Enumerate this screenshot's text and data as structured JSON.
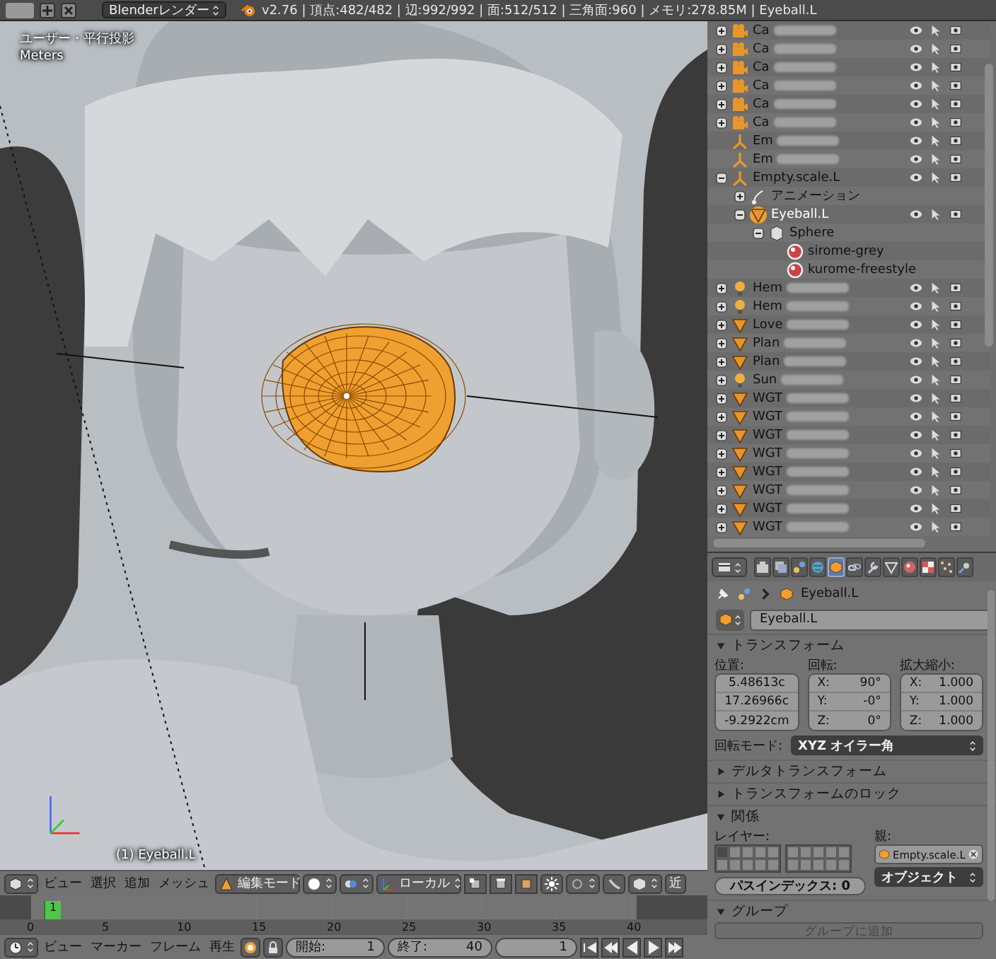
{
  "top_bar": {
    "render_engine": "Blenderレンダー",
    "stats": "v2.76 | 頂点:482/482 | 辺:992/992 | 面:512/512 | 三角面:960 | メモリ:278.85M | Eyeball.L"
  },
  "viewport": {
    "view_name": "ユーザー・平行投影",
    "units": "Meters",
    "active_object": "(1) Eyeball.L"
  },
  "viewport_header": {
    "menus": [
      "ビュー",
      "選択",
      "追加",
      "メッシュ"
    ],
    "mode": "編集モード",
    "orientation": "ローカル",
    "clipped_label": "近"
  },
  "timeline": {
    "ticks": [
      "0",
      "5",
      "10",
      "15",
      "20",
      "25",
      "30",
      "35",
      "40"
    ],
    "current_frame": "1"
  },
  "timeline_header": {
    "menus": [
      "ビュー",
      "マーカー",
      "フレーム",
      "再生"
    ],
    "start": {
      "label": "開始:",
      "value": "1"
    },
    "end": {
      "label": "終了:",
      "value": "40"
    },
    "frame": "1"
  },
  "outliner": {
    "items": [
      {
        "name": "Ca",
        "kind": "camera",
        "expanded": false,
        "selected": false,
        "blurred": true
      },
      {
        "name": "Ca",
        "kind": "camera",
        "expanded": false,
        "selected": false,
        "blurred": true
      },
      {
        "name": "Ca",
        "kind": "camera",
        "expanded": false,
        "selected": false,
        "blurred": true
      },
      {
        "name": "Ca",
        "kind": "camera",
        "expanded": false,
        "selected": false,
        "blurred": true
      },
      {
        "name": "Ca",
        "kind": "camera",
        "expanded": false,
        "selected": false,
        "blurred": true
      },
      {
        "name": "Ca",
        "kind": "camera",
        "expanded": false,
        "selected": false,
        "blurred": true
      },
      {
        "name": "Em",
        "kind": "empty",
        "selected": false,
        "blurred": true
      },
      {
        "name": "Em",
        "kind": "empty",
        "selected": false,
        "blurred": true
      },
      {
        "name": "Empty.scale.L",
        "kind": "empty",
        "expanded": true,
        "selected": false,
        "children": [
          {
            "name": "アニメーション",
            "kind": "animation",
            "expanded": false,
            "selected": false
          },
          {
            "name": "Eyeball.L",
            "kind": "mesh",
            "expanded": true,
            "selected": true,
            "children": [
              {
                "name": "Sphere",
                "kind": "meshdata",
                "expanded": true,
                "selected": false,
                "children": [
                  {
                    "name": "sirome-grey",
                    "kind": "material",
                    "selected": false
                  },
                  {
                    "name": "kurome-freestyle",
                    "kind": "material",
                    "selected": false
                  }
                ]
              }
            ]
          }
        ]
      },
      {
        "name": "Hem",
        "kind": "lamp",
        "expanded": false,
        "selected": false,
        "blurred": true
      },
      {
        "name": "Hem",
        "kind": "lamp",
        "expanded": false,
        "selected": false,
        "blurred": true
      },
      {
        "name": "Love",
        "kind": "mesh",
        "expanded": false,
        "selected": false,
        "blurred": true
      },
      {
        "name": "Plan",
        "kind": "mesh",
        "expanded": false,
        "selected": false,
        "blurred": true
      },
      {
        "name": "Plan",
        "kind": "mesh",
        "expanded": false,
        "selected": false,
        "blurred": true
      },
      {
        "name": "Sun",
        "kind": "lamp",
        "expanded": false,
        "selected": false,
        "blurred": true
      },
      {
        "name": "WGT",
        "kind": "mesh",
        "expanded": false,
        "selected": false,
        "blurred": true
      },
      {
        "name": "WGT",
        "kind": "mesh",
        "expanded": false,
        "selected": false,
        "blurred": true
      },
      {
        "name": "WGT",
        "kind": "mesh",
        "expanded": false,
        "selected": false,
        "blurred": true
      },
      {
        "name": "WGT",
        "kind": "mesh",
        "expanded": false,
        "selected": false,
        "blurred": true
      },
      {
        "name": "WGT",
        "kind": "mesh",
        "expanded": false,
        "selected": false,
        "blurred": true
      },
      {
        "name": "WGT",
        "kind": "mesh",
        "expanded": false,
        "selected": false,
        "blurred": true
      },
      {
        "name": "WGT",
        "kind": "mesh",
        "expanded": false,
        "selected": false,
        "blurred": true
      },
      {
        "name": "WGT",
        "kind": "mesh",
        "expanded": false,
        "selected": false,
        "blurred": true
      }
    ]
  },
  "properties": {
    "tabs": [
      {
        "kind": "render",
        "selected": false
      },
      {
        "kind": "layers",
        "selected": false
      },
      {
        "kind": "scene",
        "selected": false
      },
      {
        "kind": "world",
        "selected": false
      },
      {
        "kind": "object",
        "selected": true
      },
      {
        "kind": "constraints",
        "selected": false
      },
      {
        "kind": "modifiers",
        "selected": false
      },
      {
        "kind": "data",
        "selected": false
      },
      {
        "kind": "material",
        "selected": false
      },
      {
        "kind": "texture",
        "selected": false
      },
      {
        "kind": "particles",
        "selected": false
      },
      {
        "kind": "physics",
        "selected": false
      }
    ],
    "breadcrumb": "Eyeball.L",
    "object_name": "Eyeball.L",
    "panels": [
      {
        "kind": "transform",
        "title": "トランスフォーム",
        "expanded": true,
        "location_label": "位置:",
        "location": [
          "5.48613c",
          "17.26966c",
          "-9.2922cm"
        ],
        "rotation_label": "回転:",
        "rotation": [
          {
            "axis": "X:",
            "value": "90°"
          },
          {
            "axis": "Y:",
            "value": "-0°"
          },
          {
            "axis": "Z:",
            "value": "0°"
          }
        ],
        "scale_label": "拡大縮小:",
        "scale": [
          {
            "axis": "X:",
            "value": "1.000"
          },
          {
            "axis": "Y:",
            "value": "1.000"
          },
          {
            "axis": "Z:",
            "value": "1.000"
          }
        ],
        "rotation_mode_label": "回転モード:",
        "rotation_mode": "XYZ オイラー角"
      },
      {
        "title": "デルタトランスフォーム",
        "expanded": false
      },
      {
        "title": "トランスフォームのロック",
        "expanded": false
      },
      {
        "kind": "relations",
        "title": "関係",
        "expanded": true,
        "layers_label": "レイヤー:",
        "layers": [
          true,
          false,
          false,
          false,
          false,
          false,
          false,
          false,
          false,
          false,
          false,
          false,
          false,
          false,
          false,
          false,
          false,
          false,
          false,
          false
        ],
        "parent_label": "親:",
        "parent": "Empty.scale.L",
        "parent_type": "オブジェクト",
        "pass_index": "パスインデックス: 0"
      },
      {
        "kind": "groups",
        "title": "グループ",
        "expanded": true,
        "add_button": "グループに追加"
      }
    ]
  }
}
